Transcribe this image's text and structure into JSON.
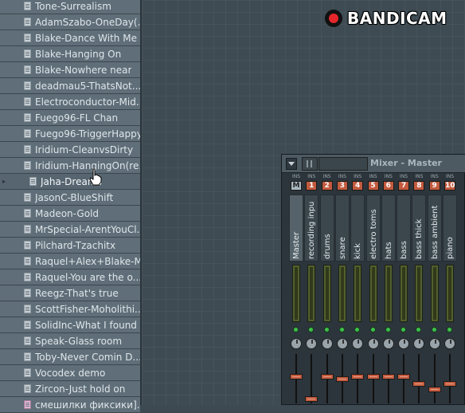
{
  "browser": {
    "items": [
      {
        "label": "Tone-Surrealism",
        "type": "file"
      },
      {
        "label": "AdamSzabo-OneDay(...",
        "type": "file"
      },
      {
        "label": "Blake-Dance With Me",
        "type": "file"
      },
      {
        "label": "Blake-Hanging On",
        "type": "file"
      },
      {
        "label": "Blake-Nowhere near",
        "type": "file"
      },
      {
        "label": "deadmau5-ThatsNot...",
        "type": "file"
      },
      {
        "label": "Electroconductor-Mid...",
        "type": "file"
      },
      {
        "label": "Fuego96-FL Chan",
        "type": "file"
      },
      {
        "label": "Fuego96-TriggerHappy",
        "type": "file"
      },
      {
        "label": "Iridium-CleanvsDirty",
        "type": "file"
      },
      {
        "label": "Iridium-HangingOn(re...",
        "type": "file"
      },
      {
        "label": "Jaha-Dreams",
        "type": "file",
        "selected": true
      },
      {
        "label": "JasonC-BlueShift",
        "type": "file"
      },
      {
        "label": "Madeon-Gold",
        "type": "file"
      },
      {
        "label": "MrSpecial-ArentYouCl...",
        "type": "file"
      },
      {
        "label": "Pilchard-Tzachitx",
        "type": "file"
      },
      {
        "label": "Raquel+Alex+Blake-M...",
        "type": "file"
      },
      {
        "label": "Raquel-You are the o...",
        "type": "file"
      },
      {
        "label": "Reegz-That's true",
        "type": "file"
      },
      {
        "label": "ScottFisher-Moholithi...",
        "type": "file"
      },
      {
        "label": "SolidInc-What I found",
        "type": "file"
      },
      {
        "label": "Speak-Glass room",
        "type": "file"
      },
      {
        "label": "Toby-Never Comin D...",
        "type": "file"
      },
      {
        "label": "Vocodex demo",
        "type": "file"
      },
      {
        "label": "Zircon-Just hold on",
        "type": "file"
      },
      {
        "label": "смешилки фиксики]...",
        "type": "file-alt"
      }
    ]
  },
  "watermark": {
    "text": "BANDICAM",
    "rec_color": "#e5262b"
  },
  "mixer": {
    "title": "Mixer - Master",
    "insert_label": "INS",
    "tracks": [
      {
        "num": "M",
        "name": "Master",
        "fader_level": 0.55,
        "master": true
      },
      {
        "num": "1",
        "name": "recording inpu",
        "fader_level": 0.05
      },
      {
        "num": "2",
        "name": "drums",
        "fader_level": 0.55
      },
      {
        "num": "3",
        "name": "snare",
        "fader_level": 0.5
      },
      {
        "num": "4",
        "name": "kick",
        "fader_level": 0.55
      },
      {
        "num": "5",
        "name": "electro toms",
        "fader_level": 0.55
      },
      {
        "num": "6",
        "name": "hats",
        "fader_level": 0.55
      },
      {
        "num": "7",
        "name": "bass",
        "fader_level": 0.55
      },
      {
        "num": "8",
        "name": "bass thick",
        "fader_level": 0.4
      },
      {
        "num": "9",
        "name": "bass ambient",
        "fader_level": 0.27
      },
      {
        "num": "10",
        "name": "piano",
        "fader_level": 0.4
      }
    ]
  },
  "colors": {
    "fader": "#c55c3e",
    "insert_number": "#c25a3e",
    "led": "#3dc04a"
  }
}
